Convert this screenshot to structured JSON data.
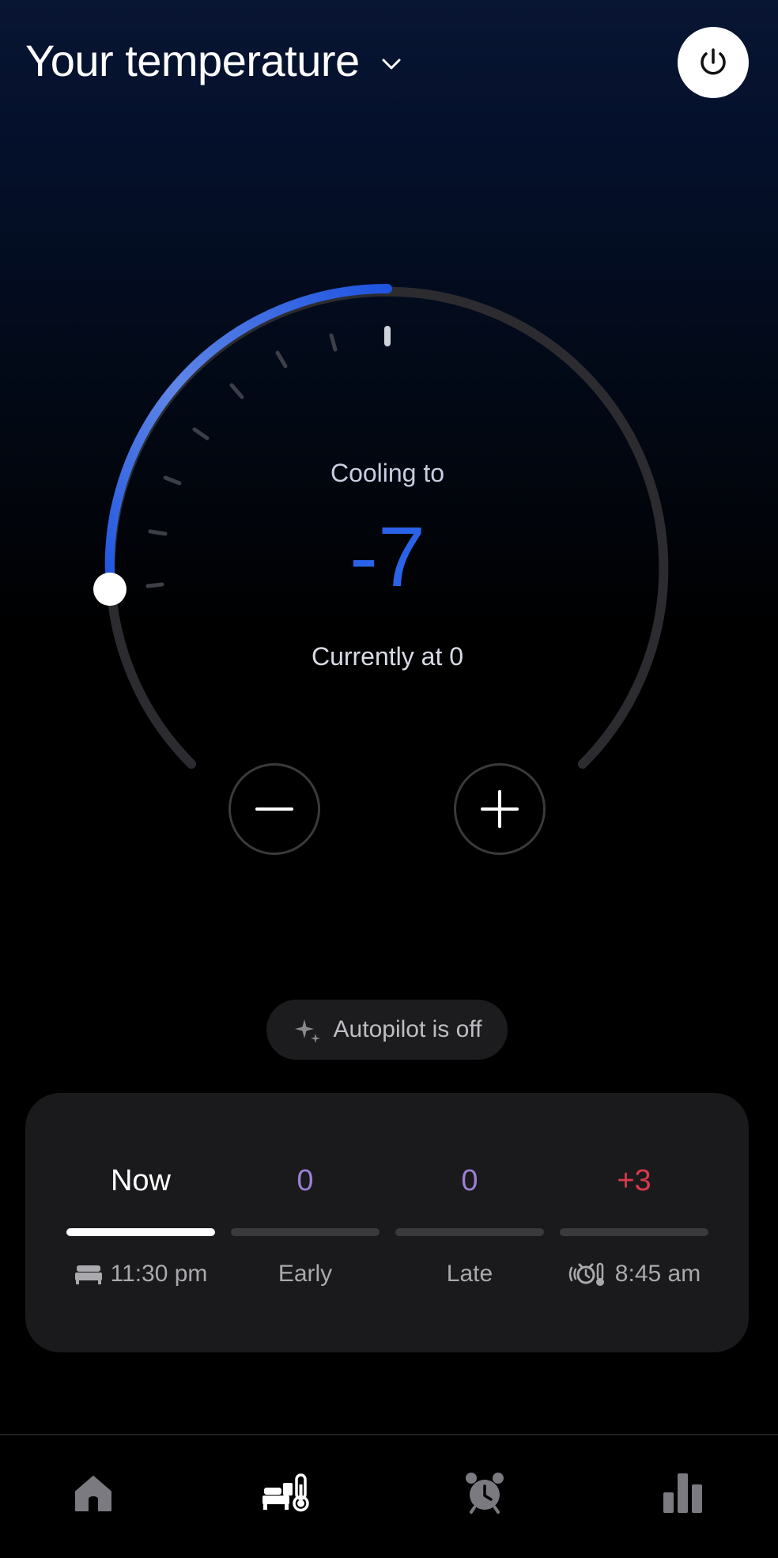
{
  "header": {
    "title": "Your temperature"
  },
  "dial": {
    "status_label": "Cooling to",
    "target_value": "-7",
    "current_label": "Currently at 0",
    "level_fraction": 0.25,
    "accent_color": "#2a62e8"
  },
  "autopilot": {
    "label": "Autopilot is off"
  },
  "schedule": {
    "columns": [
      {
        "value": "Now",
        "label": "11:30 pm",
        "value_color": "#ffffff",
        "icon": "bed-icon",
        "active": true
      },
      {
        "value": "0",
        "label": "Early",
        "value_color": "#9b7fd4",
        "active": false
      },
      {
        "value": "0",
        "label": "Late",
        "value_color": "#9b7fd4",
        "active": false
      },
      {
        "value": "+3",
        "label": "8:45 am",
        "value_color": "#d9394b",
        "icon": "alarm-thermometer-icon",
        "active": false
      }
    ]
  },
  "nav": {
    "items": [
      {
        "icon": "home-icon",
        "active": false
      },
      {
        "icon": "bed-thermometer-icon",
        "active": true
      },
      {
        "icon": "alarm-clock-icon",
        "active": false
      },
      {
        "icon": "bar-chart-icon",
        "active": false
      }
    ]
  }
}
